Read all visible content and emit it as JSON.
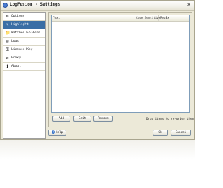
{
  "window": {
    "title": "LogFusion - Settings",
    "close_glyph": "✕"
  },
  "sidebar": {
    "items": [
      {
        "label": "Options",
        "icon": "options-icon",
        "glyph": "⚙"
      },
      {
        "label": "Highlight",
        "icon": "highlight-icon",
        "glyph": "✎"
      },
      {
        "label": "Watched Folders",
        "icon": "folder-icon",
        "glyph": "📁"
      },
      {
        "label": "Logs",
        "icon": "logs-icon",
        "glyph": "▤"
      },
      {
        "label": "License Key",
        "icon": "key-icon",
        "glyph": "⚿"
      },
      {
        "label": "Proxy",
        "icon": "proxy-icon",
        "glyph": "⇄"
      },
      {
        "label": "About",
        "icon": "about-icon",
        "glyph": "ℹ"
      }
    ],
    "selected_index": 1
  },
  "highlight": {
    "columns": [
      "Text",
      "Case Sensitive",
      "RegEx"
    ],
    "add_label": "Add",
    "edit_label": "Edit",
    "remove_label": "Remove",
    "hint": "Drag items to re-order them"
  },
  "footer": {
    "help_label": "Help",
    "ok_label": "Ok",
    "cancel_label": "Cancel"
  },
  "colors": {
    "selected": "#3a6ea5",
    "window_bg": "#ece9d8"
  }
}
